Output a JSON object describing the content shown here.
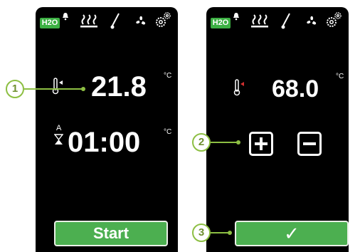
{
  "status_bar": {
    "h2o_label": "H2O",
    "icons": [
      "bell-icon",
      "steam-icon",
      "probe-icon",
      "fan-icon",
      "gears-icon"
    ]
  },
  "left_screen": {
    "temperature_value": "21.8",
    "temperature_unit": "°C",
    "timer_prefix": "A",
    "timer_value": "01:00",
    "timer_unit": "°C",
    "start_button": "Start"
  },
  "right_screen": {
    "temperature_value": "68.0",
    "temperature_unit": "°C",
    "plus_icon": "plus-icon",
    "minus_icon": "minus-icon",
    "confirm_button": "✓"
  },
  "callouts": [
    "1",
    "2",
    "3"
  ],
  "colors": {
    "accent_green": "#4caf50",
    "callout_green": "#8dbf43",
    "screen_bg": "#000000",
    "indicator_red": "#d32f2f"
  }
}
